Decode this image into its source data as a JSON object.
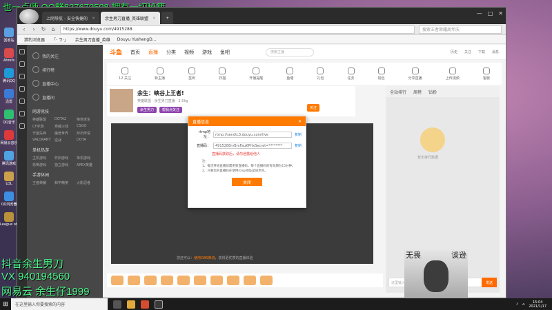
{
  "overlays": {
    "top_text": "也一点师 QQ群827670598 拥有一切秘籍",
    "bottom": [
      "抖音余生男刀",
      "VX 940194560",
      "网易云 余生仔1999"
    ]
  },
  "desktop_icons": [
    "回收站",
    "Ahrefs",
    "腾讯QQ",
    "迅雷",
    "QQ音乐",
    "网易云音乐",
    "腾讯游戏",
    "LOL",
    "QQ浏览器",
    "League of Legends",
    "斗鱼",
    "英雄联盟"
  ],
  "browser": {
    "tabs": [
      {
        "label": "上网导航 - 安全快捷的",
        "active": false
      },
      {
        "label": "余生男刀直播_英雄联盟",
        "active": true
      }
    ],
    "window_controls": [
      "—",
      "□",
      "✕"
    ],
    "url": "https://www.douyu.com/4915288",
    "search_placeholder": "搜索王者荣耀周年庆",
    "bookmarks": [
      "猎豹浏览器",
      "「· ラ·」",
      "余生男刀直播_英雄",
      "Douyu YushengD..."
    ]
  },
  "site": {
    "logo": "斗鱼",
    "nav": [
      "首页",
      "直播",
      "分类",
      "视频",
      "游戏",
      "鱼吧"
    ],
    "active_nav": "直播",
    "search_placeholder": "搜索主播",
    "top_icons": [
      "历史",
      "关注",
      "下载",
      "消息"
    ],
    "categories": [
      "12 关注",
      "新主播",
      "签到",
      "扫描",
      "开播提醒",
      "鱼塘",
      "礼包",
      "任务",
      "钱包",
      "分享直播",
      "写弹幕",
      "打卡",
      "上传视频",
      "公会",
      "客服"
    ],
    "left_menu": [
      "我的关注",
      "排行榜",
      "直播中心",
      "直播间"
    ],
    "left_sections": [
      {
        "title": "网游竞技",
        "items": [
          "英雄联盟",
          "DOTA2",
          "绝地求生",
          "CF手游",
          "穿越火线",
          "CSGO",
          "守望先锋",
          "魔兽世界",
          "炉石传说",
          "VALORANT",
          "逆战",
          "DOTA"
        ]
      },
      {
        "title": "单机热游",
        "items": [
          "主机游戏",
          "怀旧游戏",
          "单机游戏",
          "恐怖游戏",
          "独立游戏",
          "APEX英雄"
        ]
      },
      {
        "title": "手游休闲",
        "items": [
          "王者荣耀",
          "和平精英",
          "火影忍者"
        ]
      }
    ]
  },
  "room": {
    "title": "余生：峡谷上王者!",
    "meta": "英雄联盟 · 余生男刀直播 · 2.5kg",
    "tags": [
      "余生男刀",
      "帮我点关注"
    ],
    "follow": "关注"
  },
  "modal": {
    "title": "直播信息",
    "close_x": "✕",
    "rtmp_label": "rtmp地址：",
    "rtmp_value": "rtmp://sendtc3.douyu.com/live",
    "key_label": "直播码：",
    "key_value": "4915288rvBmFauKPHxSecret=********",
    "copy": "复制",
    "warning": "直播码获取后，请勿泄露给他人",
    "notes": [
      "注：",
      "1、每次开始直播前需更新直播码，每个直播码的有效期为15分钟。",
      "2、只要您的直播码在使用rtmp地址是同步的。"
    ],
    "close_button": "关闭"
  },
  "player_note": {
    "prefix": "您还可以：",
    "link": "使用OBS推流",
    "suffix": "，获得更优质的直播体验"
  },
  "right_col": {
    "tabs": [
      "全站排行",
      "周榜",
      "钻粉"
    ],
    "mascot_text": "暂无排行数据",
    "chat_placeholder": "这里输入聊天内容",
    "send": "发送"
  },
  "webcam": {
    "text_left": "无畏",
    "text_right": "谈逊"
  },
  "taskbar": {
    "search": "在这里输入你要搜索的内容",
    "time": "15:04",
    "date": "2021/1/17"
  }
}
